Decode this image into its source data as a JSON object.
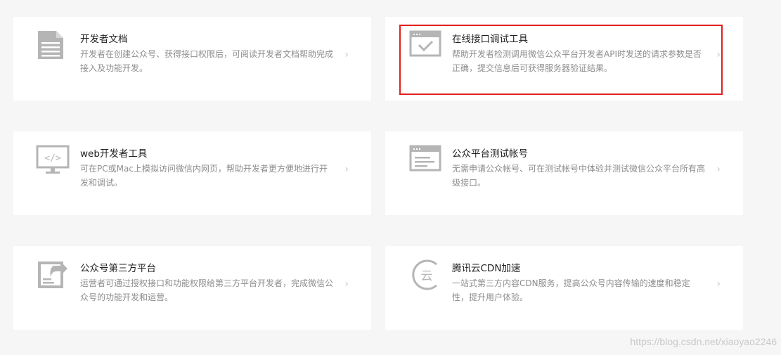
{
  "cards": [
    {
      "title": "开发者文档",
      "desc": "开发者在创建公众号、获得接口权限后，可阅读开发者文档帮助完成接入及功能开发。",
      "icon": "document-icon",
      "chevron": "›"
    },
    {
      "title": "在线接口调试工具",
      "desc": "帮助开发者检测调用微信公众平台开发者API时发送的请求参数是否正确，提交信息后可获得服务器验证结果。",
      "icon": "browser-check-icon",
      "chevron": "›"
    },
    {
      "title": "web开发者工具",
      "desc": "可在PC或Mac上模拟访问微信内网页，帮助开发者更方便地进行开发和调试。",
      "icon": "monitor-code-icon",
      "chevron": "›"
    },
    {
      "title": "公众平台测试帐号",
      "desc": "无需申请公众帐号、可在测试帐号中体验并测试微信公众平台所有高级接口。",
      "icon": "browser-test-icon",
      "chevron": "›"
    },
    {
      "title": "公众号第三方平台",
      "desc": "运营者可通过授权接口和功能权限给第三方平台开发者，完成微信公众号的功能开发和运营。",
      "icon": "third-party-icon",
      "chevron": "›"
    },
    {
      "title": "腾讯云CDN加速",
      "desc": "一站式第三方内容CDN服务，提高公众号内容传输的速度和稳定性，提升用户体验。",
      "icon": "cloud-cdn-icon",
      "chevron": "›"
    }
  ],
  "watermark": "https://blog.csdn.net/xiaoyao2246",
  "colors": {
    "highlight_border": "#e0201e",
    "icon_gray": "#b5b5b5",
    "title": "#222222",
    "desc": "#8d8d8d"
  }
}
